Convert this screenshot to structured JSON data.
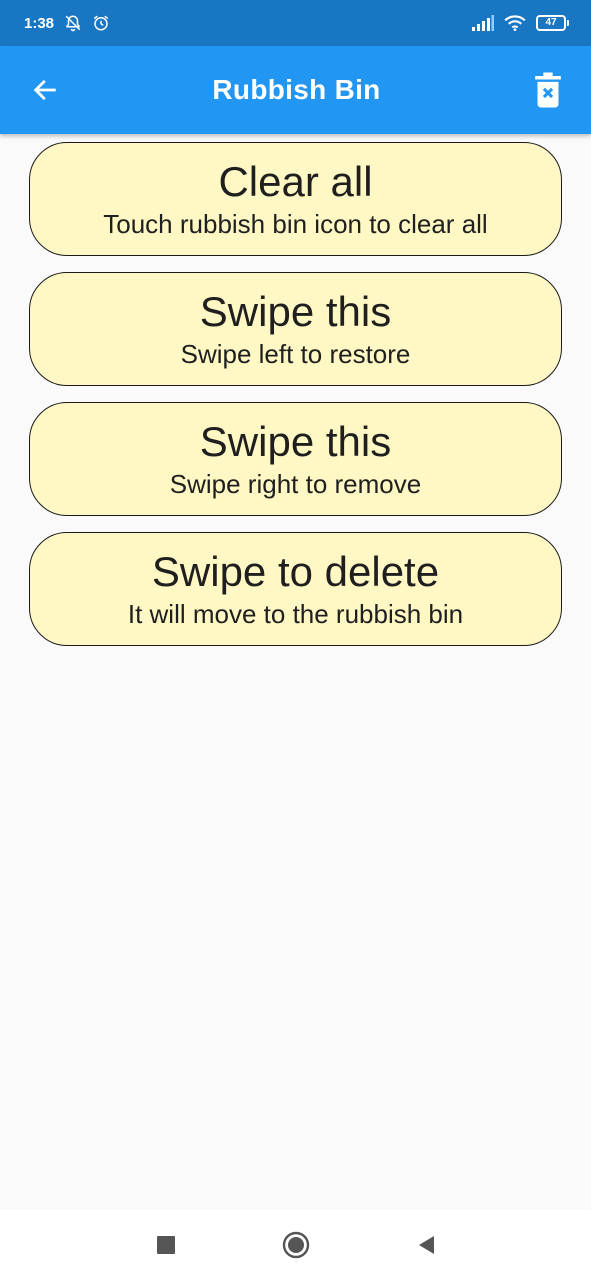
{
  "status_bar": {
    "time": "1:38",
    "battery": "47",
    "icons": [
      "bell-off-icon",
      "alarm-icon",
      "signal-icon",
      "wifi-icon",
      "battery-icon"
    ]
  },
  "app_bar": {
    "title": "Rubbish Bin",
    "back_icon": "arrow-left-icon",
    "action_icon": "delete-forever-icon",
    "color": "#2196f3"
  },
  "cards": [
    {
      "title": "Clear all",
      "subtitle": "Touch rubbish bin icon to clear all"
    },
    {
      "title": "Swipe this",
      "subtitle": "Swipe left to restore"
    },
    {
      "title": "Swipe this",
      "subtitle": "Swipe right to remove"
    },
    {
      "title": "Swipe to delete",
      "subtitle": "It will move to the rubbish bin"
    }
  ],
  "card_color": "#fff8c4",
  "nav_bar": {
    "icons": [
      "recents-square-icon",
      "home-circle-icon",
      "back-triangle-icon"
    ]
  }
}
